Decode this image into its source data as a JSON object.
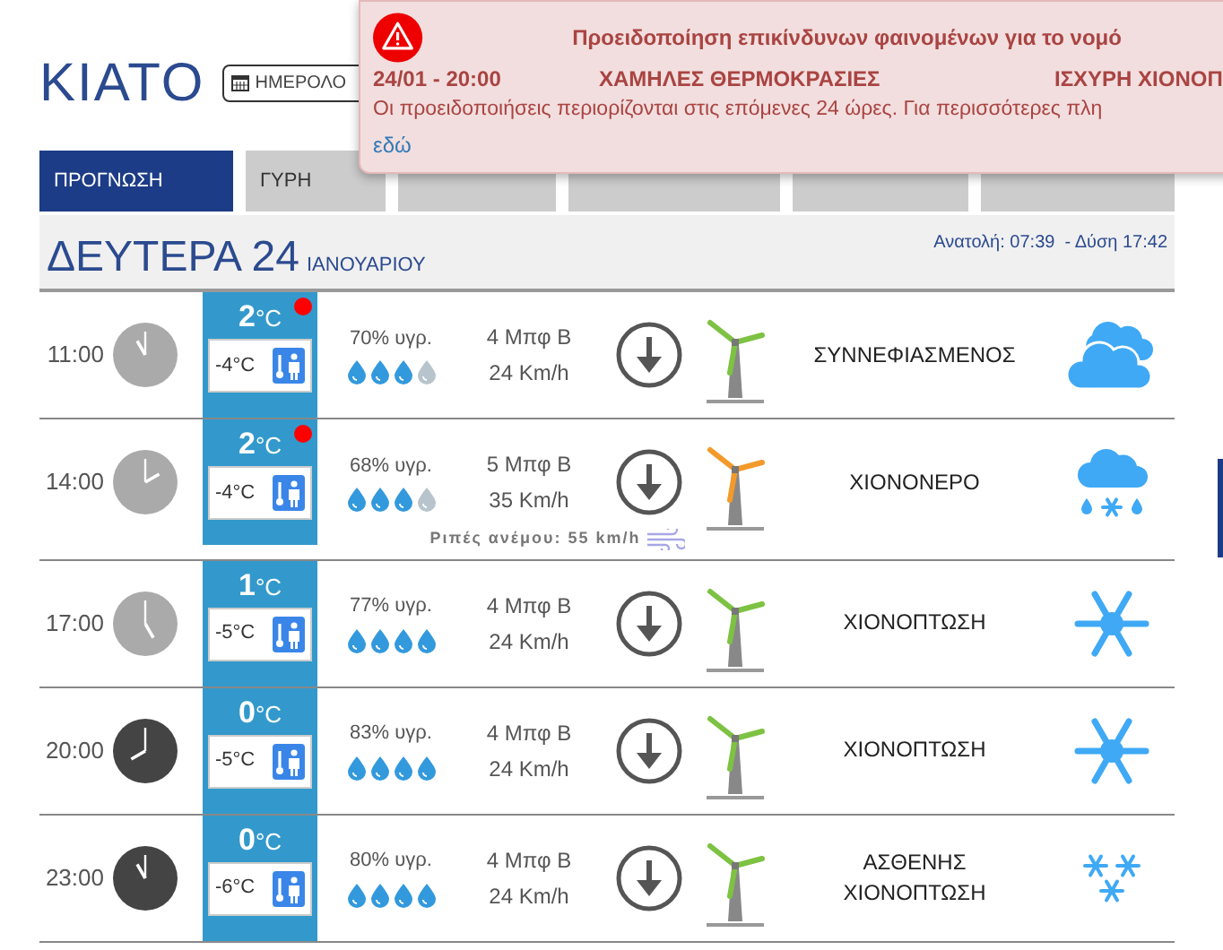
{
  "header": {
    "city": "ΚΙΑΤΟ",
    "calendar_button": "ΗΜΕΡΟΛΟ"
  },
  "tabs": [
    {
      "label": "ΠΡΟΓΝΩΣΗ",
      "selected": true
    },
    {
      "label": "ΓΥΡΗ",
      "selected": false
    },
    {
      "selected": false
    },
    {
      "selected": false
    },
    {
      "selected": false
    },
    {
      "selected": false
    }
  ],
  "alert": {
    "title": "Προειδοποίηση επικίνδυνων φαινομένων για το νομό",
    "items": [
      "24/01 - 20:00",
      "ΧΑΜΗΛΕΣ ΘΕΡΜΟΚΡΑΣΙΕΣ",
      "ΙΣΧΥΡΗ ΧΙΟΝΟΠ"
    ],
    "note": "Οι προειδοποιήσεις περιορίζονται στις επόμενες 24 ώρες. Για περισσότερες πλη",
    "link": "εδώ"
  },
  "day": {
    "weekday": "ΔΕΥΤΕΡΑ 24",
    "month": "ΙΑΝΟΥΑΡΙΟΥ",
    "sun": "Ανατολή: 07:39  - Δύση 17:42"
  },
  "rows": [
    {
      "time": "11:00",
      "night": false,
      "temp": "2",
      "unit": "°C",
      "feel": "-4°C",
      "alert": true,
      "humidity": "70% υγρ.",
      "stars": 3,
      "beaufort": "4 Μπφ Β",
      "speed": "24 Km/h",
      "color": "#7dc242",
      "description": "ΣΥΝΝΕΦΙΑΣΜΕΝΟΣ",
      "kind": "cloudy"
    },
    {
      "time": "14:00",
      "night": false,
      "temp": "2",
      "unit": "°C",
      "feel": "-4°C",
      "alert": true,
      "humidity": "68% υγρ.",
      "stars": 3,
      "beaufort": "5 Μπφ Β",
      "speed": "35 Km/h",
      "gust": "Ριπές ανέμου: 55 km/h",
      "color": "#f39a2b",
      "description": "ΧΙΟΝΟΝΕΡΟ",
      "kind": "sleet"
    },
    {
      "time": "17:00",
      "night": false,
      "temp": "1",
      "unit": "°C",
      "feel": "-5°C",
      "alert": false,
      "humidity": "77% υγρ.",
      "stars": 4,
      "beaufort": "4 Μπφ Β",
      "speed": "24 Km/h",
      "color": "#7dc242",
      "description": "ΧΙΟΝΟΠΤΩΣΗ",
      "kind": "snow"
    },
    {
      "time": "20:00",
      "night": true,
      "temp": "0",
      "unit": "°C",
      "feel": "-5°C",
      "alert": false,
      "humidity": "83% υγρ.",
      "stars": 4,
      "beaufort": "4 Μπφ Β",
      "speed": "24 Km/h",
      "color": "#7dc242",
      "description": "ΧΙΟΝΟΠΤΩΣΗ",
      "kind": "snow"
    },
    {
      "time": "23:00",
      "night": true,
      "temp": "0",
      "unit": "°C",
      "feel": "-6°C",
      "alert": false,
      "humidity": "80% υγρ.",
      "stars": 4,
      "beaufort": "4 Μπφ Β",
      "speed": "24 Km/h",
      "color": "#7dc242",
      "description": "ΑΣΘΕΝΗΣ ΧΙΟΝΟΠΤΩΣΗ",
      "kind": "light-snow"
    }
  ]
}
